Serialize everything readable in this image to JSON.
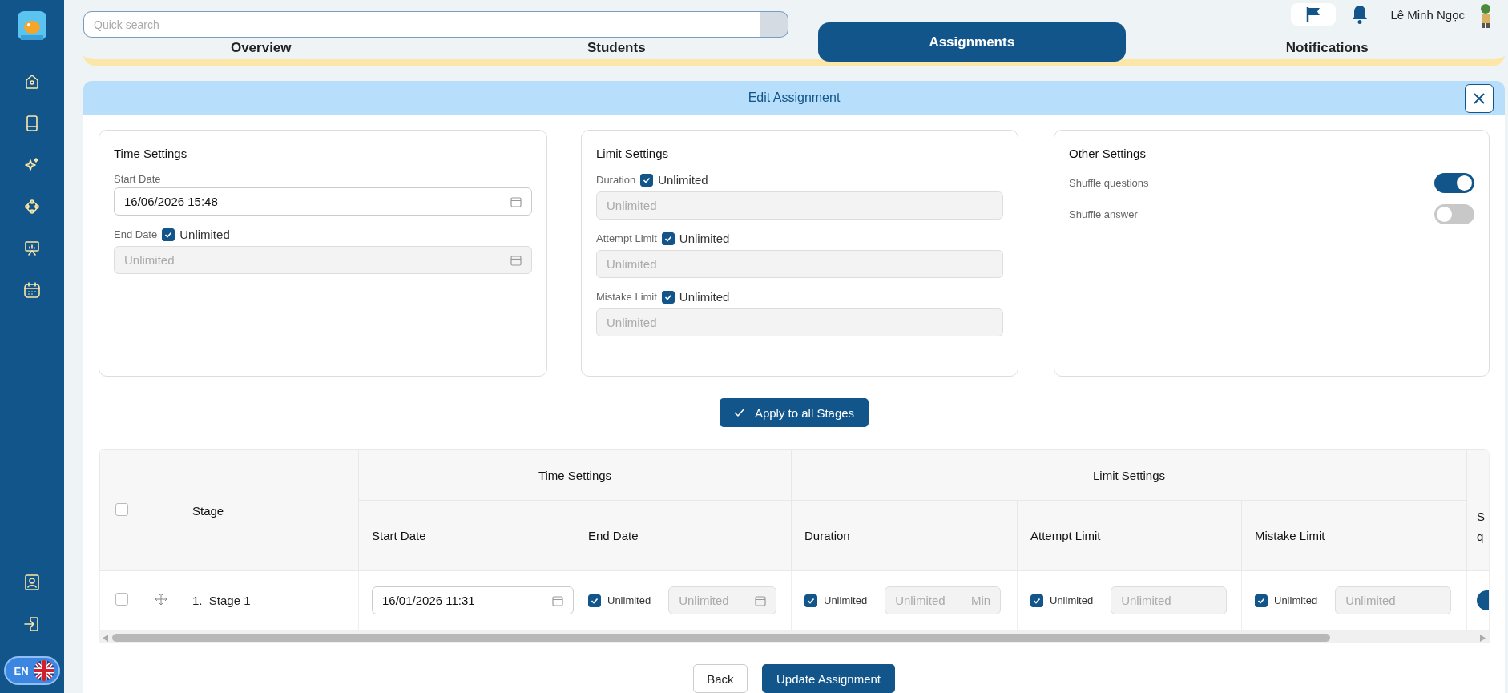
{
  "sidebar": {
    "items": [
      {
        "selected": false
      },
      {
        "selected": false
      },
      {
        "selected": false
      },
      {
        "selected": false
      },
      {
        "selected": false
      },
      {
        "selected": false
      }
    ],
    "language": "EN"
  },
  "search": {
    "placeholder": "Quick search"
  },
  "tabs": [
    {
      "label": "Overview",
      "selected": false
    },
    {
      "label": "Students",
      "selected": false
    },
    {
      "label": "Assignments",
      "selected": true
    },
    {
      "label": "Notifications",
      "selected": false
    }
  ],
  "user": {
    "name": "Lê Minh Ngọc"
  },
  "dialog": {
    "title": "Edit Assignment",
    "time_settings": {
      "title": "Time Settings",
      "start_label": "Start Date",
      "start_value": "16/06/2026 15:48",
      "end_label": "End Date",
      "end_unlimited": true,
      "unlimited_label": "Unlimited",
      "end_placeholder": "Unlimited"
    },
    "limit_settings": {
      "title": "Limit Settings",
      "fields": [
        {
          "label": "Duration",
          "unlimited": true,
          "unlimited_label": "Unlimited",
          "placeholder": "Unlimited"
        },
        {
          "label": "Attempt Limit",
          "unlimited": true,
          "unlimited_label": "Unlimited",
          "placeholder": "Unlimited"
        },
        {
          "label": "Mistake Limit",
          "unlimited": true,
          "unlimited_label": "Unlimited",
          "placeholder": "Unlimited"
        }
      ]
    },
    "other_settings": {
      "title": "Other Settings",
      "toggles": [
        {
          "label": "Shuffle questions",
          "on": true
        },
        {
          "label": "Shuffle answer",
          "on": false
        }
      ]
    },
    "apply_button": "Apply to all Stages",
    "table": {
      "group_headers": [
        "Time Settings",
        "Limit Settings"
      ],
      "stage_header": "Stage",
      "columns": [
        "Start Date",
        "End Date",
        "Duration",
        "Attempt Limit",
        "Mistake Limit"
      ],
      "column_9": [
        "S",
        "q"
      ],
      "rows": [
        {
          "checked": false,
          "number": "1.",
          "name": "Stage 1",
          "start": "16/01/2026 11:31",
          "end_unlimited": true,
          "end_placeholder": "Unlimited",
          "duration_unlimited": true,
          "duration_placeholder": "Unlimited",
          "duration_unit": "Min",
          "attempt_unlimited": true,
          "attempt_placeholder": "Unlimited",
          "mistake_unlimited": true,
          "mistake_placeholder": "Unlimited",
          "end_label": "Unlimited",
          "duration_label": "Unlimited",
          "attempt_label": "Unlimited",
          "mistake_label": "Unlimited",
          "shuffle_on": true
        }
      ],
      "all_checked": false
    },
    "buttons": [
      {
        "label": "Back",
        "kind": "secondary"
      },
      {
        "label": "Update Assignment",
        "kind": "primary"
      }
    ]
  }
}
